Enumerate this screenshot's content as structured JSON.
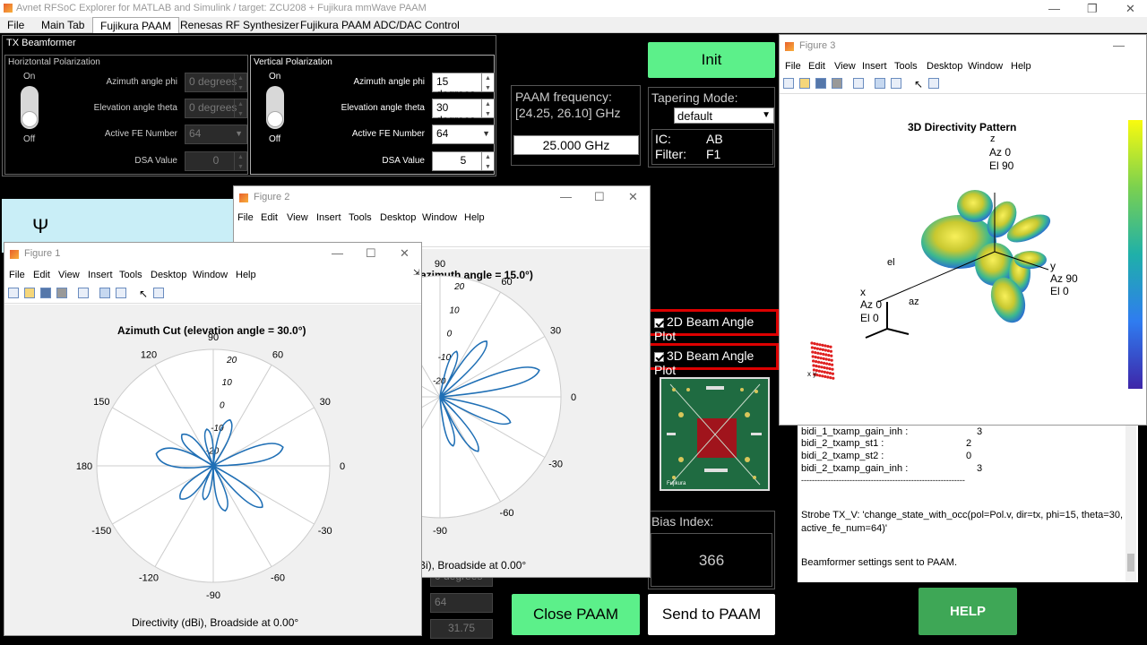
{
  "window": {
    "title": "Avnet RFSoC Explorer for MATLAB and Simulink / target: ZCU208 + Fujikura mmWave PAAM"
  },
  "tabs": [
    "File",
    "Main Tab",
    "Fujikura PAAM",
    "Renesas RF Synthesizer",
    "Fujikura PAAM ADC/DAC Control"
  ],
  "tx": {
    "title": "TX Beamformer",
    "horizontal": {
      "title": "Horiztontal Polarization",
      "on": "On",
      "off": "Off",
      "az_label": "Azimuth angle phi",
      "az_value": "0 degrees",
      "el_label": "Elevation angle theta",
      "el_value": "0 degrees",
      "fe_label": "Active FE Number",
      "fe_value": "64",
      "dsa_label": "DSA Value",
      "dsa_value": "0"
    },
    "vertical": {
      "title": "Vertical Polarization",
      "on": "On",
      "off": "Off",
      "az_label": "Azimuth angle phi",
      "az_value": "15 degrees",
      "el_label": "Elevation angle theta",
      "el_value": "30 degrees",
      "fe_label": "Active FE Number",
      "fe_value": "64",
      "dsa_label": "DSA Value",
      "dsa_value": "5"
    }
  },
  "init_label": "Init",
  "paam": {
    "freq_label": "PAAM frequency:",
    "freq_range": "[24.25, 26.10] GHz",
    "freq_value": "25.000 GHz"
  },
  "tapering": {
    "label": "Tapering Mode:",
    "value": "default",
    "ic_label": "IC:",
    "ic_value": "AB",
    "filter_label": "Filter:",
    "filter_value": "F1"
  },
  "plots": {
    "beam2d": "2D Beam Angle Plot",
    "beam3d": "3D Beam Angle Plot"
  },
  "bias": {
    "label": "Bias Index:",
    "value": "366"
  },
  "buttons": {
    "close": "Close PAAM",
    "send": "Send to PAAM",
    "help": "HELP"
  },
  "hidden_fields": {
    "field1": "0 degrees",
    "field2": "64",
    "field3": "31.75"
  },
  "log": {
    "lines": [
      {
        "k": "bidi_1_txamp_gain_inh :",
        "v": "3"
      },
      {
        "k": "bidi_2_txamp_st1 :",
        "v": "2"
      },
      {
        "k": "bidi_2_txamp_st2 :",
        "v": "0"
      },
      {
        "k": "bidi_2_txamp_gain_inh :",
        "v": "3"
      }
    ],
    "separator": "-------------------------------------------------------------",
    "strobe": "Strobe TX_V: 'change_state_with_occ(pol=Pol.v, dir=tx, phi=15, theta=30, active_fe_num=64)'",
    "sent": "Beamformer settings sent to PAAM."
  },
  "figure_menu": [
    "File",
    "Edit",
    "View",
    "Insert",
    "Tools",
    "Desktop",
    "Window",
    "Help"
  ],
  "figure1": {
    "title": "Figure 1",
    "plot_title": "Azimuth Cut (elevation angle = 30.0°)",
    "caption": "Directivity (dBi), Broadside at 0.00°",
    "angle_labels": [
      "90",
      "60",
      "30",
      "0",
      "-30",
      "-60",
      "-90",
      "-120",
      "-150",
      "180",
      "150",
      "120"
    ],
    "radial_labels": [
      "20",
      "10",
      "0",
      "-10",
      "-20"
    ]
  },
  "figure2": {
    "title": "Figure 2",
    "plot_title": "azimuth angle = 15.0°)",
    "caption": "Bi), Broadside at 0.00°",
    "angle_labels": [
      "90",
      "60",
      "30",
      "0",
      "-30",
      "-60",
      "-90"
    ],
    "radial_labels": [
      "20",
      "10",
      "0",
      "-10",
      "-20"
    ]
  },
  "figure3": {
    "title": "Figure 3",
    "plot_title": "3D Directivity Pattern",
    "z_label": "z",
    "z_az": "Az 0",
    "z_el": "El 90",
    "y_label": "y",
    "y_az": "Az 90",
    "y_el": "El 0",
    "x_label": "x",
    "x_az": "Az 0",
    "x_el": "El 0",
    "el_label": "el",
    "az_label": "az",
    "xy_label": "x y"
  },
  "colors": {
    "accent_green": "#5cf08a",
    "help_green": "#3ea756",
    "plot_blue": "#1f6fb5",
    "highlight_red": "#dd0000"
  }
}
